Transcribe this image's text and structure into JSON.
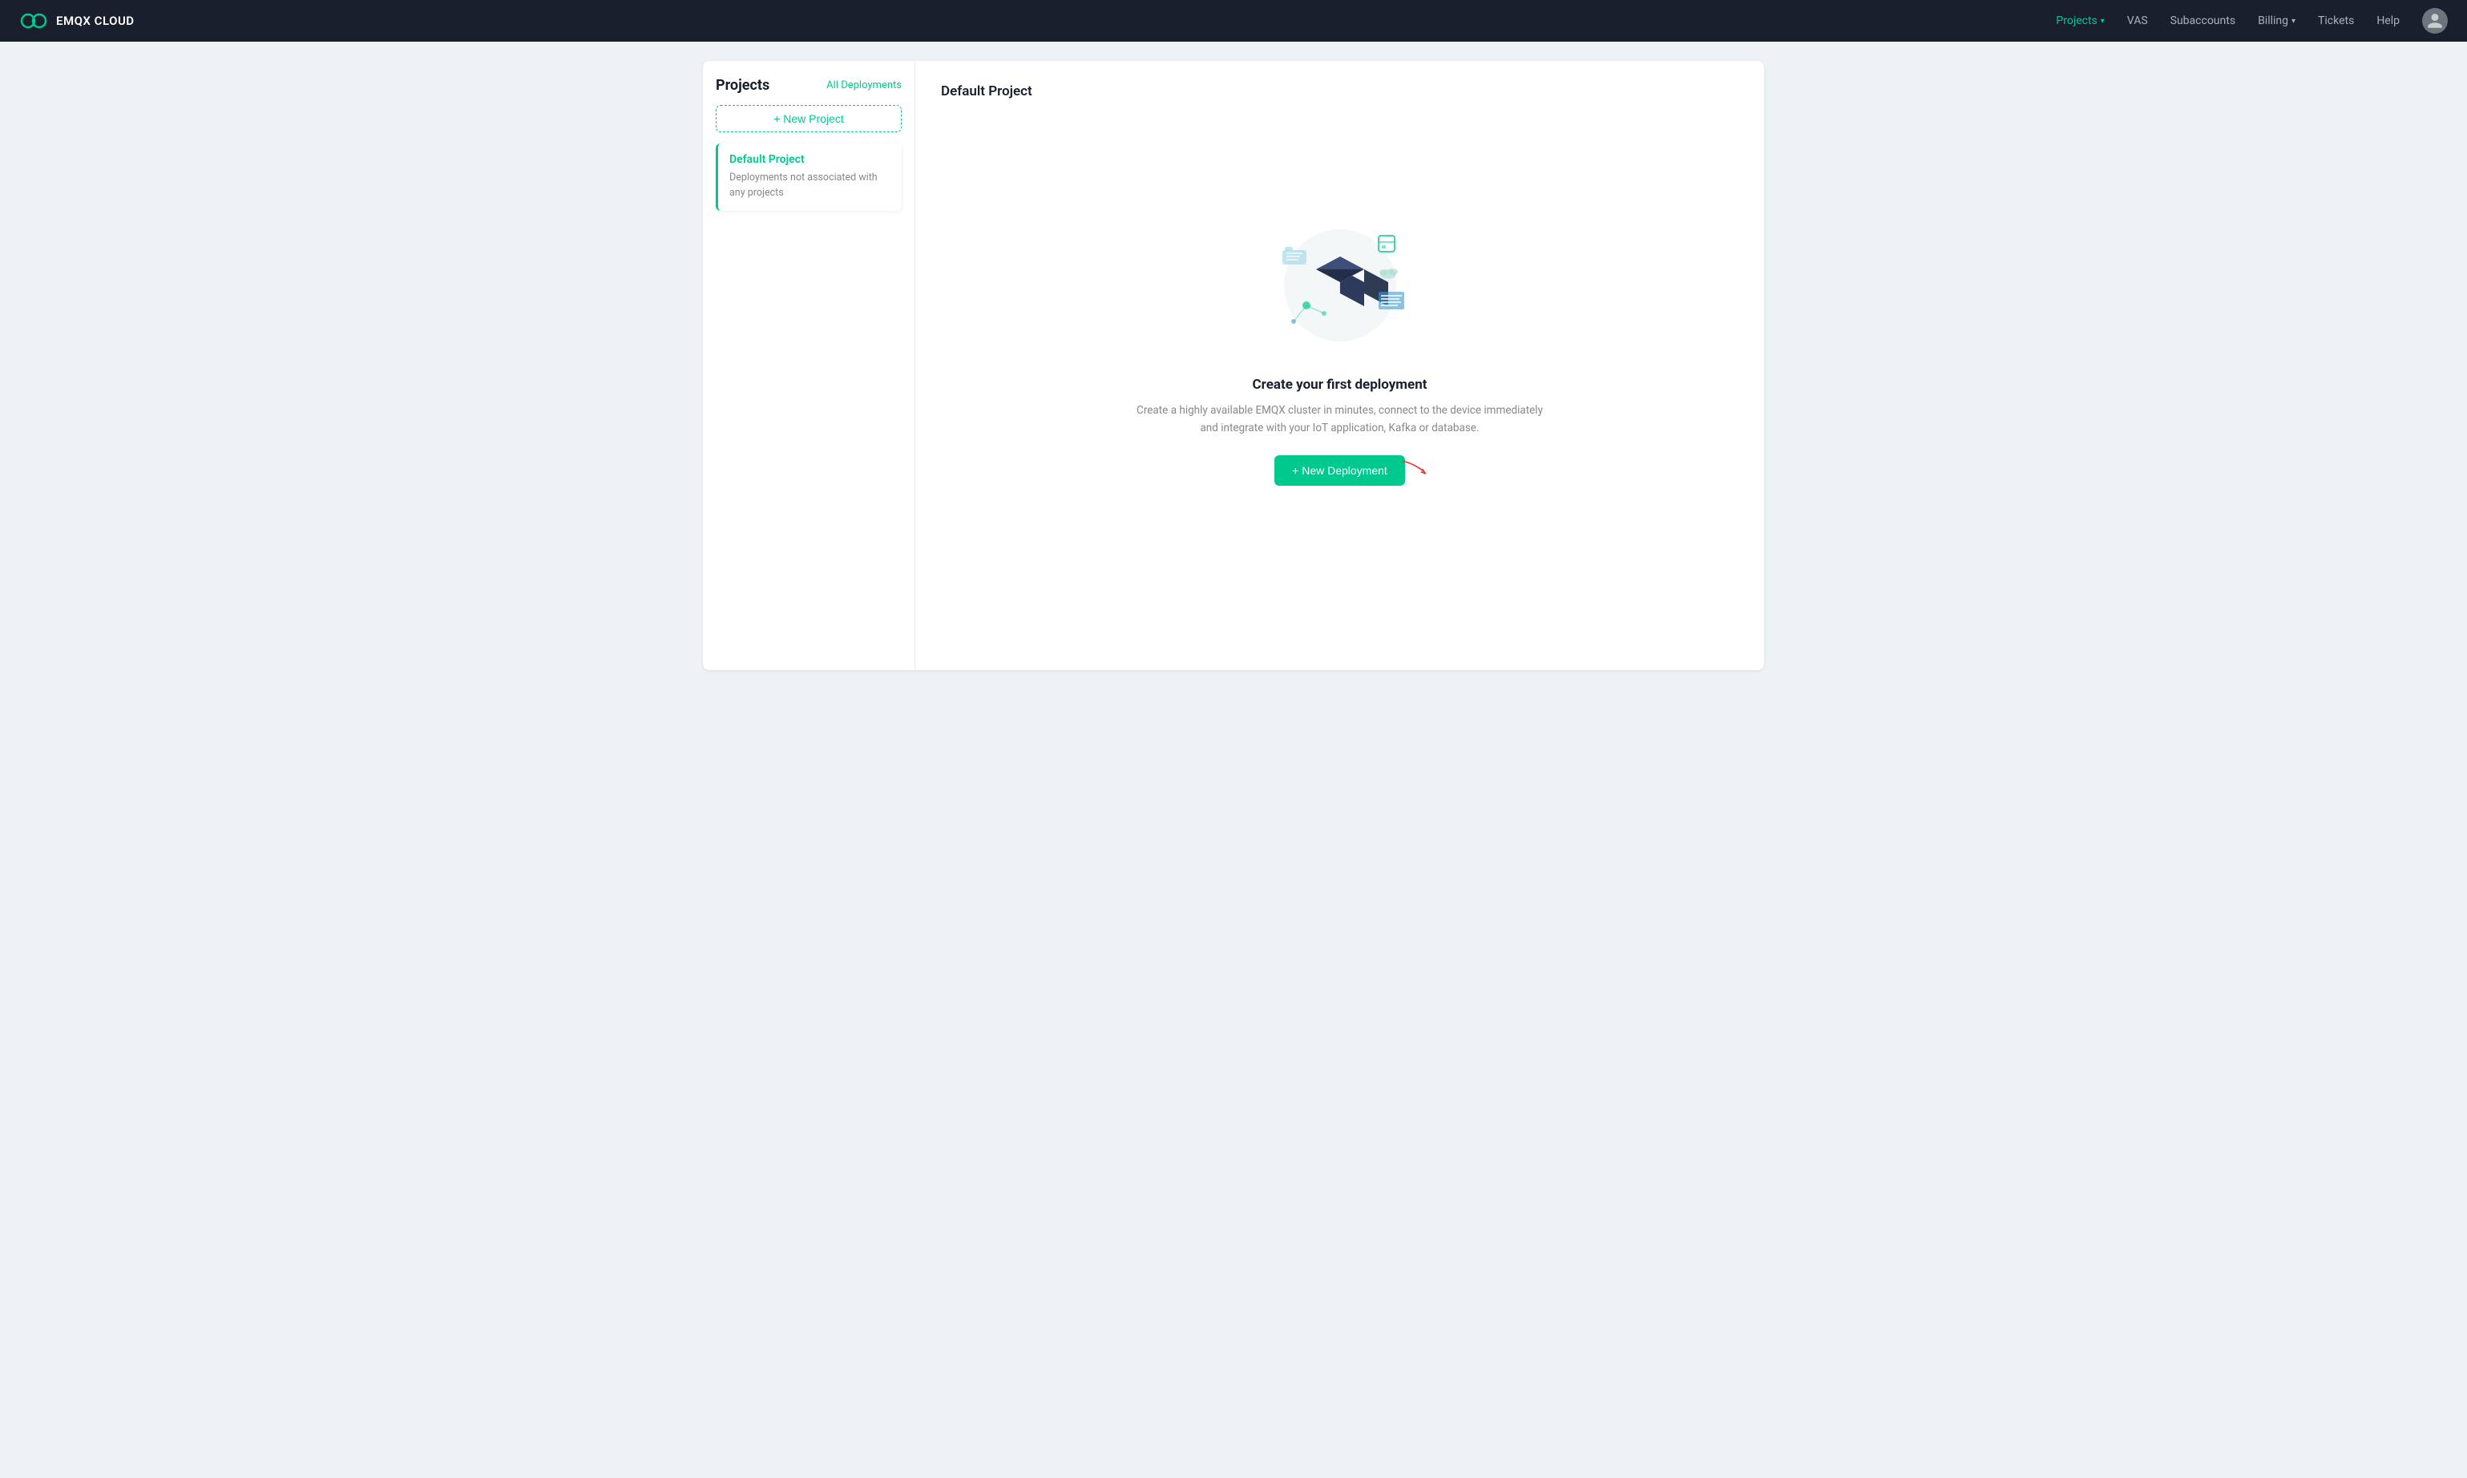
{
  "navbar": {
    "logo_text": "EMQX CLOUD",
    "nav_items": [
      {
        "label": "Projects",
        "active": true,
        "has_arrow": true
      },
      {
        "label": "VAS",
        "active": false,
        "has_arrow": false
      },
      {
        "label": "Subaccounts",
        "active": false,
        "has_arrow": false
      },
      {
        "label": "Billing",
        "active": false,
        "has_arrow": true
      },
      {
        "label": "Tickets",
        "active": false,
        "has_arrow": false
      },
      {
        "label": "Help",
        "active": false,
        "has_arrow": false
      }
    ]
  },
  "sidebar": {
    "title": "Projects",
    "all_deployments_label": "All Deployments",
    "new_project_label": "+ New Project",
    "projects": [
      {
        "name": "Default Project",
        "description": "Deployments not associated with any projects",
        "active": true
      }
    ]
  },
  "main": {
    "section_title": "Default Project",
    "empty_state": {
      "title": "Create your first deployment",
      "description": "Create a highly available EMQX cluster in minutes, connect to the device immediately and integrate with your IoT application, Kafka or database.",
      "new_deployment_label": "+ New Deployment"
    }
  }
}
